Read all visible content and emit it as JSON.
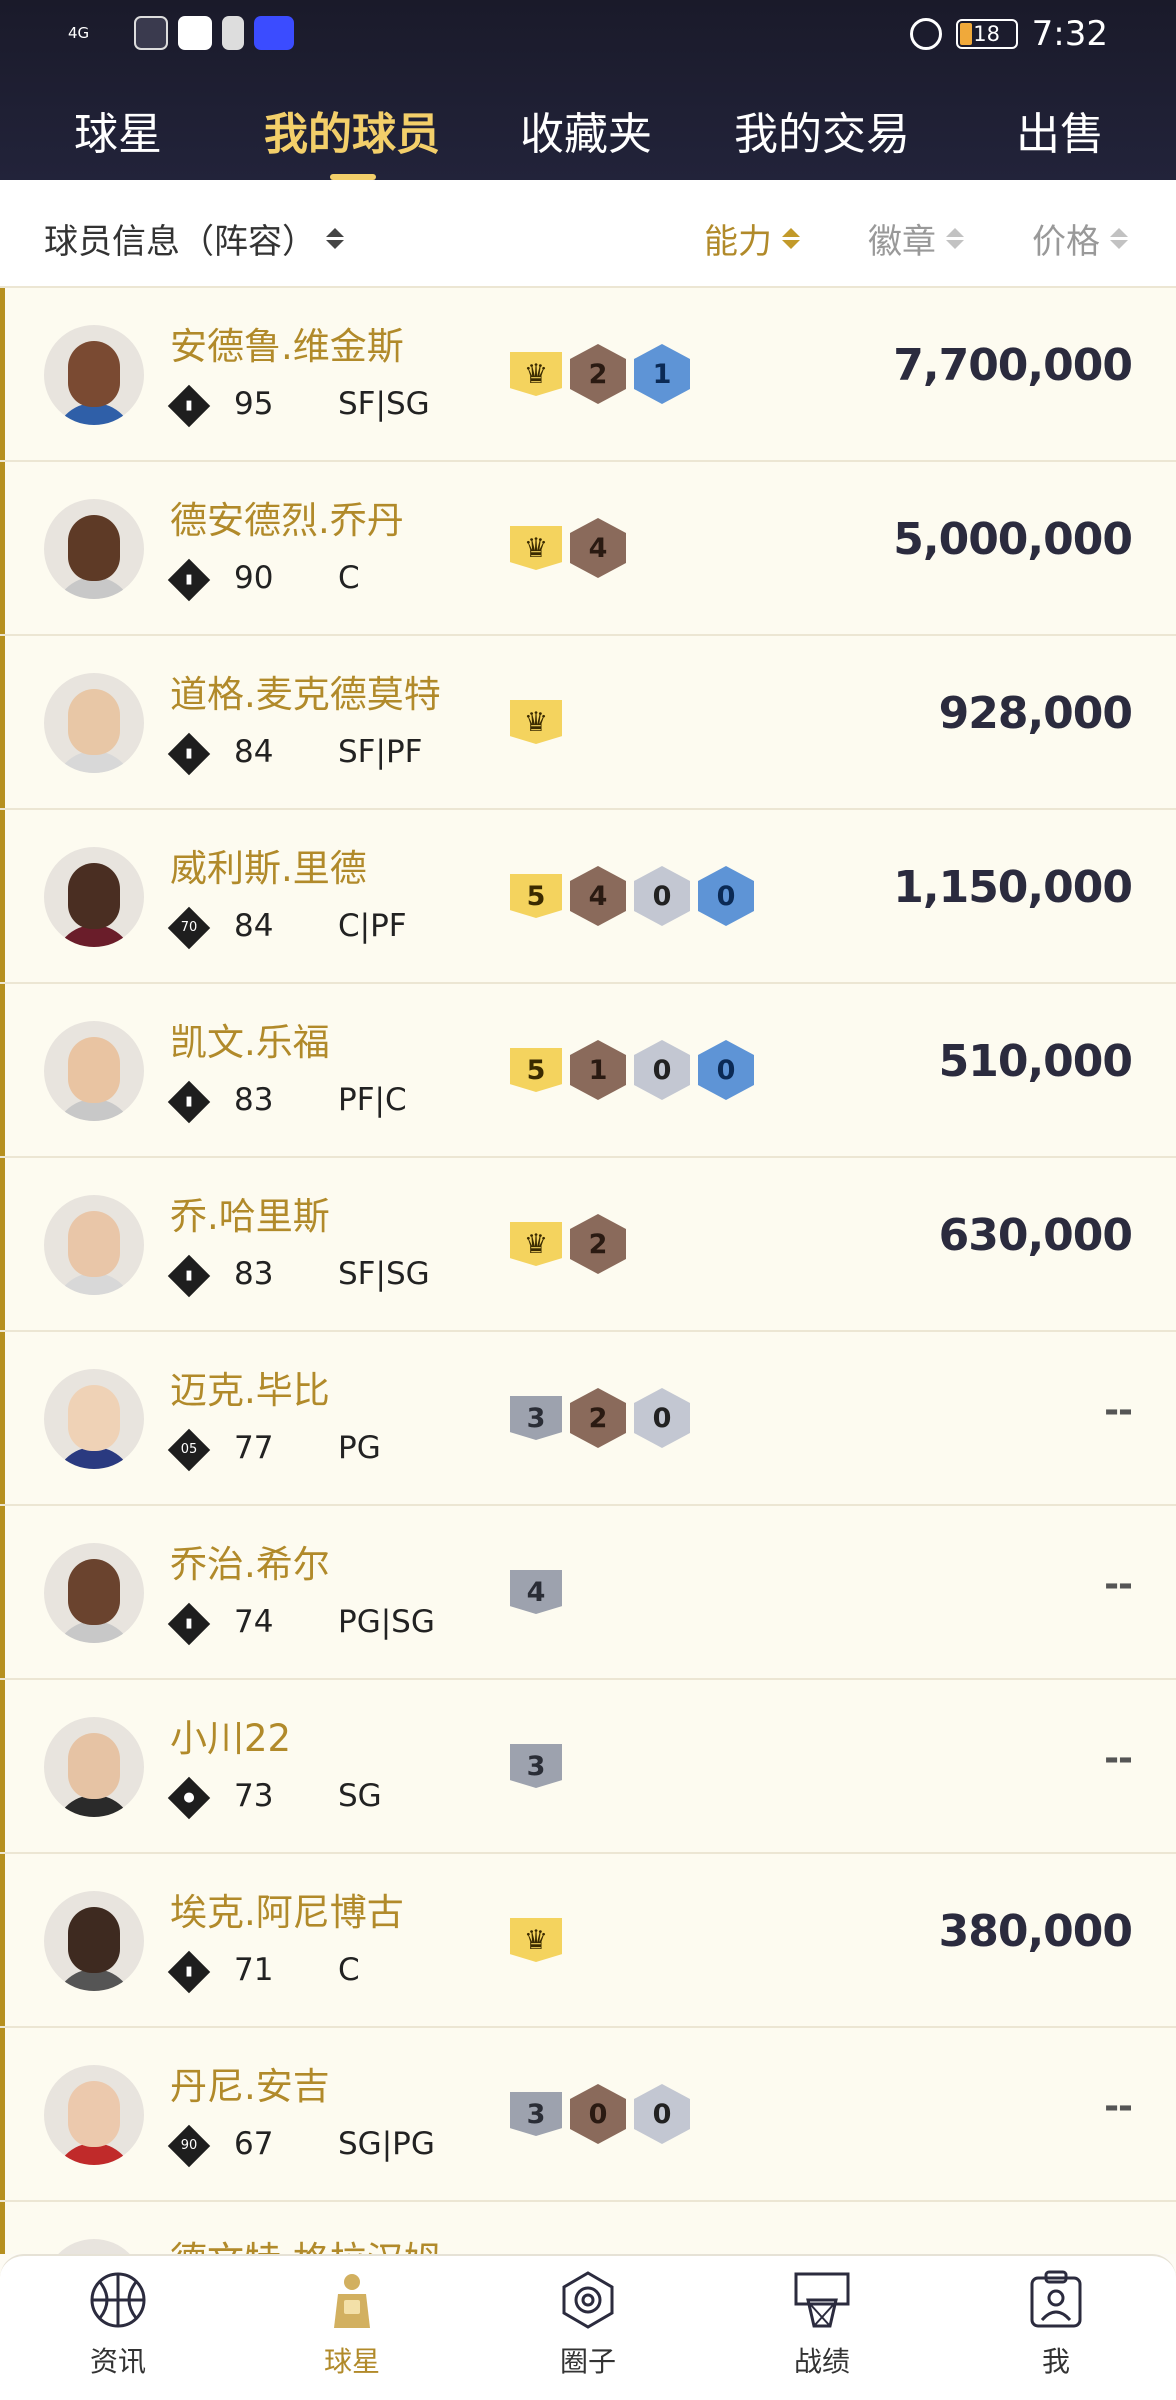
{
  "status_bar": {
    "network": "4G",
    "battery": "18",
    "time": "7:32"
  },
  "tabs": [
    {
      "label": "球星",
      "active": false
    },
    {
      "label": "我的球员",
      "active": true
    },
    {
      "label": "收藏夹",
      "active": false
    },
    {
      "label": "我的交易",
      "active": false
    },
    {
      "label": "出售",
      "active": false
    }
  ],
  "sort_bar": {
    "info_label": "球员信息（阵容）",
    "ability_label": "能力",
    "badge_label": "徽章",
    "price_label": "价格"
  },
  "players": [
    {
      "name": "安德鲁.维金斯",
      "ovr": "95",
      "pos": "SF|SG",
      "ovr_icon": "chart-icon",
      "tier": {
        "type": "crown",
        "label": "♛"
      },
      "badges": [
        {
          "type": "bronze",
          "v": "2"
        },
        {
          "type": "blue",
          "v": "1"
        }
      ],
      "price": "7,700,000",
      "lineup": true
    },
    {
      "name": "德安德烈.乔丹",
      "ovr": "90",
      "pos": "C",
      "ovr_icon": "chart-icon",
      "tier": {
        "type": "crown",
        "label": "♛"
      },
      "badges": [
        {
          "type": "bronze",
          "v": "4"
        }
      ],
      "price": "5,000,000",
      "lineup": true
    },
    {
      "name": "道格.麦克德莫特",
      "ovr": "84",
      "pos": "SF|PF",
      "ovr_icon": "chart-icon",
      "tier": {
        "type": "crown",
        "label": "♛"
      },
      "badges": [],
      "price": "928,000",
      "lineup": true
    },
    {
      "name": "威利斯.里德",
      "ovr": "84",
      "pos": "C|PF",
      "ovr_icon": "70",
      "tier": {
        "type": "gold",
        "label": "5"
      },
      "badges": [
        {
          "type": "bronze",
          "v": "4"
        },
        {
          "type": "silver",
          "v": "0"
        },
        {
          "type": "blue",
          "v": "0"
        }
      ],
      "price": "1,150,000",
      "lineup": true
    },
    {
      "name": "凯文.乐福",
      "ovr": "83",
      "pos": "PF|C",
      "ovr_icon": "chart-icon",
      "tier": {
        "type": "gold",
        "label": "5"
      },
      "badges": [
        {
          "type": "bronze",
          "v": "1"
        },
        {
          "type": "silver",
          "v": "0"
        },
        {
          "type": "blue",
          "v": "0"
        }
      ],
      "price": "510,000",
      "lineup": true
    },
    {
      "name": "乔.哈里斯",
      "ovr": "83",
      "pos": "SF|SG",
      "ovr_icon": "chart-icon",
      "tier": {
        "type": "crown",
        "label": "♛"
      },
      "badges": [
        {
          "type": "bronze",
          "v": "2"
        }
      ],
      "price": "630,000",
      "lineup": true
    },
    {
      "name": "迈克.毕比",
      "ovr": "77",
      "pos": "PG",
      "ovr_icon": "05",
      "tier": {
        "type": "silver",
        "label": "3"
      },
      "badges": [
        {
          "type": "bronze",
          "v": "2"
        },
        {
          "type": "silver",
          "v": "0"
        }
      ],
      "price": "--",
      "lineup": true
    },
    {
      "name": "乔治.希尔",
      "ovr": "74",
      "pos": "PG|SG",
      "ovr_icon": "chart-icon",
      "tier": {
        "type": "silver",
        "label": "4"
      },
      "badges": [],
      "price": "--",
      "lineup": true
    },
    {
      "name": "小川22",
      "ovr": "73",
      "pos": "SG",
      "ovr_icon": "person-icon",
      "tier": {
        "type": "silver",
        "label": "3"
      },
      "badges": [],
      "price": "--",
      "lineup": true
    },
    {
      "name": "埃克.阿尼博古",
      "ovr": "71",
      "pos": "C",
      "ovr_icon": "chart-icon",
      "tier": {
        "type": "crown",
        "label": "♛"
      },
      "badges": [],
      "price": "380,000",
      "lineup": true
    },
    {
      "name": "丹尼.安吉",
      "ovr": "67",
      "pos": "SG|PG",
      "ovr_icon": "90",
      "tier": {
        "type": "silver",
        "label": "3"
      },
      "badges": [
        {
          "type": "bronze",
          "v": "0"
        },
        {
          "type": "silver",
          "v": "0"
        }
      ],
      "price": "--",
      "lineup": true
    },
    {
      "name": "德文特.格拉汉姆",
      "ovr": "",
      "pos": "",
      "ovr_icon": "chart-icon",
      "tier": null,
      "badges": [],
      "price": "",
      "lineup": true
    }
  ],
  "bottom_nav": [
    {
      "label": "资讯",
      "icon": "basketball-icon",
      "active": false
    },
    {
      "label": "球星",
      "icon": "player-icon",
      "active": true
    },
    {
      "label": "圈子",
      "icon": "circle-icon",
      "active": false
    },
    {
      "label": "战绩",
      "icon": "hoop-icon",
      "active": false
    },
    {
      "label": "我",
      "icon": "profile-icon",
      "active": false
    }
  ]
}
